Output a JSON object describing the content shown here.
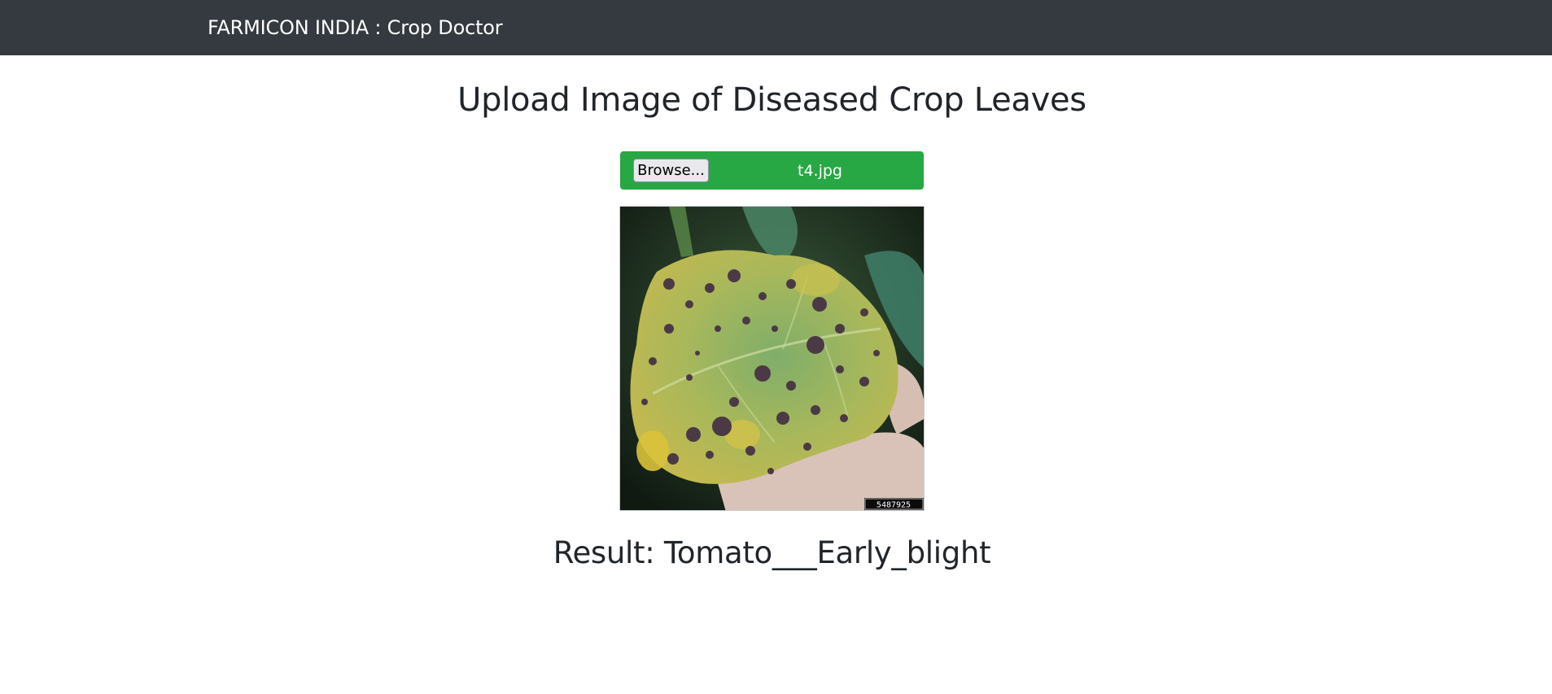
{
  "navbar": {
    "brand": "FARMICON INDIA : Crop Doctor"
  },
  "main": {
    "title": "Upload Image of Diseased Crop Leaves",
    "upload": {
      "browse_label": "Browse...",
      "file_name": "t4.jpg"
    },
    "preview": {
      "image_id_label": "5487925"
    },
    "result_text": "Result: Tomato___Early_blight"
  },
  "colors": {
    "navbar_bg": "#343a40",
    "upload_bar_bg": "#28a745"
  }
}
